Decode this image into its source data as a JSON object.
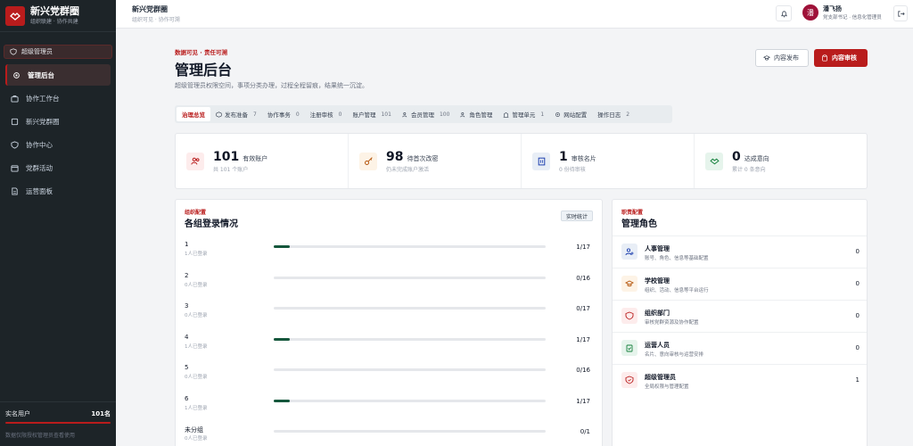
{
  "sidebar": {
    "brand_title": "新兴党群圈",
    "brand_subtitle": "组织联建 · 协作共建",
    "role_tag": "超级管理员",
    "items": [
      {
        "label": "管理后台",
        "active": true,
        "icon": "gear-icon"
      },
      {
        "label": "协作工作台",
        "active": false,
        "icon": "briefcase-icon"
      },
      {
        "label": "新兴党群圈",
        "active": false,
        "icon": "square-icon"
      },
      {
        "label": "协作中心",
        "active": false,
        "icon": "shield-icon"
      },
      {
        "label": "党群活动",
        "active": false,
        "icon": "calendar-icon"
      },
      {
        "label": "运营面板",
        "active": false,
        "icon": "document-icon"
      }
    ],
    "footer_label": "实名用户",
    "footer_value": "101名",
    "footer_note": "数据仅限授权管理员查看使用"
  },
  "topbar": {
    "title": "新兴党群圈",
    "subtitle": "组织可见 · 协作可溯",
    "user_initial": "潘",
    "user_name": "潘飞扬",
    "user_role": "党支部书记 · 信息化管理员"
  },
  "header": {
    "eyebrow": "数据可见 · 责任可溯",
    "title": "管理后台",
    "description": "超级管理员权限空间，事项分类办理，过程全程留痕，结果统一沉淀。",
    "btn_publish": "内容发布",
    "btn_review": "内容审核"
  },
  "tabs": [
    {
      "label": "治理总览",
      "count": "",
      "active": true
    },
    {
      "label": "发布准备",
      "count": "7",
      "active": false
    },
    {
      "label": "协作事务",
      "count": "0",
      "active": false
    },
    {
      "label": "注册审核",
      "count": "0",
      "active": false
    },
    {
      "label": "账户管理",
      "count": "101",
      "active": false
    },
    {
      "label": "会员管理",
      "count": "100",
      "active": false
    },
    {
      "label": "角色管理",
      "count": "",
      "active": false
    },
    {
      "label": "管理单元",
      "count": "1",
      "active": false
    },
    {
      "label": "网站配置",
      "count": "",
      "active": false
    },
    {
      "label": "操作日志",
      "count": "2",
      "active": false
    }
  ],
  "stats": [
    {
      "num": "101",
      "label": "有效账户",
      "sub": "共 101 个账户",
      "color": "#fdecec",
      "icon": "users-icon"
    },
    {
      "num": "98",
      "label": "待首次改密",
      "sub": "仍未完成账户激活",
      "color": "#fdf3e6",
      "icon": "key-icon"
    },
    {
      "num": "1",
      "label": "审核名片",
      "sub": "0 份待审核",
      "color": "#e8eef6",
      "icon": "building-icon"
    },
    {
      "num": "0",
      "label": "达成意向",
      "sub": "累计 0 条意向",
      "color": "#e6f4ec",
      "icon": "handshake-icon"
    }
  ],
  "login_panel": {
    "eyebrow": "组织配置",
    "title": "各组登录情况",
    "badge": "实时统计",
    "rows": [
      {
        "name": "1",
        "sub": "1人已登录",
        "value": 1,
        "total": 17,
        "count": "1/17"
      },
      {
        "name": "2",
        "sub": "0人已登录",
        "value": 0,
        "total": 16,
        "count": "0/16"
      },
      {
        "name": "3",
        "sub": "0人已登录",
        "value": 0,
        "total": 17,
        "count": "0/17"
      },
      {
        "name": "4",
        "sub": "1人已登录",
        "value": 1,
        "total": 17,
        "count": "1/17"
      },
      {
        "name": "5",
        "sub": "0人已登录",
        "value": 0,
        "total": 16,
        "count": "0/16"
      },
      {
        "name": "6",
        "sub": "1人已登录",
        "value": 1,
        "total": 17,
        "count": "1/17"
      },
      {
        "name": "未分组",
        "sub": "0人已登录",
        "value": 0,
        "total": 1,
        "count": "0/1"
      }
    ]
  },
  "roles_panel": {
    "eyebrow": "职责配置",
    "title": "管理角色",
    "rows": [
      {
        "name": "人事管理",
        "desc": "账号、角色、信息等基础配置",
        "count": "0",
        "color": "#e8eef6",
        "icon": "user-gear-icon"
      },
      {
        "name": "学校管理",
        "desc": "组织、活动、信息等平台运行",
        "count": "0",
        "color": "#fdf3e6",
        "icon": "graduation-icon"
      },
      {
        "name": "组织部门",
        "desc": "审核党群资源及协作配置",
        "count": "0",
        "color": "#fdecec",
        "icon": "shield-icon"
      },
      {
        "name": "运营人员",
        "desc": "名片、意向审核与运营安排",
        "count": "0",
        "color": "#e6f4ec",
        "icon": "clipboard-icon"
      },
      {
        "name": "超级管理员",
        "desc": "全局权限与管理配置",
        "count": "1",
        "color": "#fdecec",
        "icon": "shield-check-icon"
      }
    ]
  }
}
